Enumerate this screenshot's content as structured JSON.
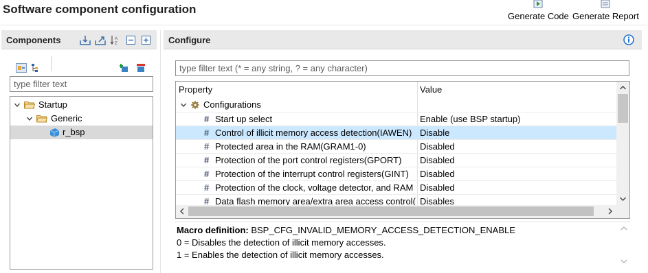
{
  "page": {
    "title": "Software component configuration"
  },
  "toolbar": {
    "generate_code": "Generate Code",
    "generate_report": "Generate Report"
  },
  "components": {
    "title": "Components",
    "filter_placeholder": "type filter text",
    "tree": [
      {
        "label": "Startup",
        "level": 0,
        "expanded": true,
        "icon": "folder-icon"
      },
      {
        "label": "Generic",
        "level": 1,
        "expanded": true,
        "icon": "folder-icon"
      },
      {
        "label": "r_bsp",
        "level": 2,
        "selected": true,
        "icon": "component-icon"
      }
    ]
  },
  "configure": {
    "title": "Configure",
    "filter_placeholder": "type filter text (* = any string, ? = any character)",
    "columns": {
      "property": "Property",
      "value": "Value"
    },
    "group": "Configurations",
    "rows": [
      {
        "property": "Start up select",
        "value": "Enable (use BSP startup)"
      },
      {
        "property": "Control of illicit memory access detection(IAWEN)",
        "value": "Disable",
        "selected": true
      },
      {
        "property": "Protected area in the RAM(GRAM1-0)",
        "value": "Disabled"
      },
      {
        "property": "Protection of the port control registers(GPORT)",
        "value": "Disabled"
      },
      {
        "property": "Protection of the interrupt control registers(GINT)",
        "value": "Disabled"
      },
      {
        "property": "Protection of the clock, voltage detector, and RAM",
        "value": "Disabled"
      },
      {
        "property": "Data flash memory area/extra area access control(I",
        "value": "Disables"
      }
    ],
    "description": {
      "macro_label": "Macro definition:",
      "macro_value": "BSP_CFG_INVALID_MEMORY_ACCESS_DETECTION_ENABLE",
      "line1": "0 = Disables the detection of illicit memory accesses.",
      "line2": "1 = Enables the detection of illicit memory accesses."
    }
  },
  "colors": {
    "selection": "#cce8ff",
    "tree_selection": "#d9d9d9",
    "header_bg": "#e9e9e9",
    "info": "#1f6fd0"
  }
}
